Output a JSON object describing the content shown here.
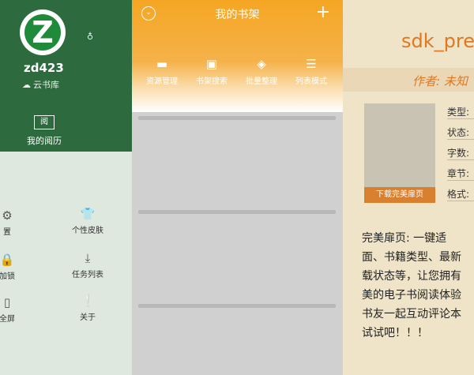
{
  "left": {
    "username": "zd423",
    "cloud_label": "云书库",
    "history_icon_char": "阅",
    "history_label": "我的阅历",
    "menu": [
      {
        "label": "置",
        "icon": "gear-icon"
      },
      {
        "label": "个性皮肤",
        "icon": "shirt-icon"
      },
      {
        "label": "加锁",
        "icon": "lock-icon"
      },
      {
        "label": "任务列表",
        "icon": "download-icon"
      },
      {
        "label": "全屏",
        "icon": "fullscreen-icon"
      },
      {
        "label": "关于",
        "icon": "info-icon"
      }
    ]
  },
  "middle": {
    "title": "我的书架",
    "tools": [
      {
        "label": "资源管理",
        "icon": "folder-icon"
      },
      {
        "label": "书架搜索",
        "icon": "book-search-icon"
      },
      {
        "label": "批量整理",
        "icon": "layers-icon"
      },
      {
        "label": "列表模式",
        "icon": "list-icon"
      }
    ]
  },
  "right": {
    "title": "sdk_pre",
    "author_label": "作者: 未知",
    "cover_button": "下载完美扉页",
    "meta": [
      "类型:",
      "状态:",
      "字数:",
      "章节:",
      "格式:"
    ],
    "body_lines": [
      "完美扉页: 一键适",
      "面、书籍类型、最新",
      "载状态等，让您拥有",
      "美的电子书阅读体验",
      "书友一起互动评论本",
      "试试吧！！！"
    ]
  },
  "colors": {
    "green_header": "#2d6b3f",
    "orange_header": "#f5a623",
    "accent_orange": "#e07820"
  }
}
